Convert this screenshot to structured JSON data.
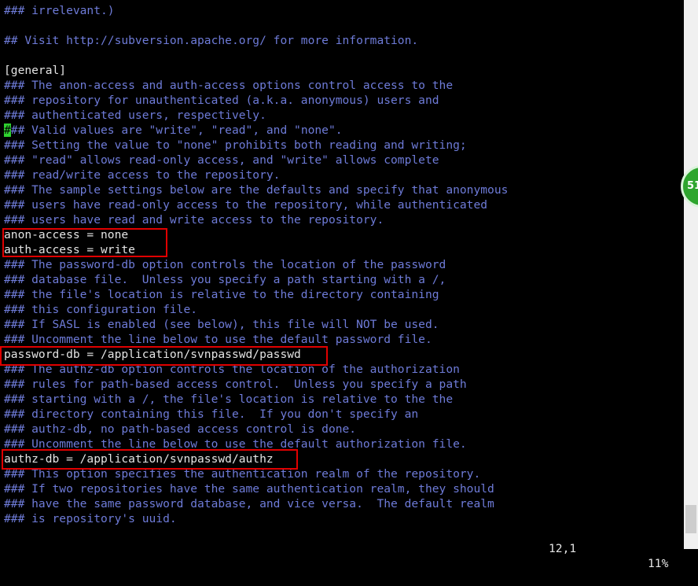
{
  "editor": {
    "lines": [
      {
        "text": "### irrelevant.)",
        "kind": "comment"
      },
      {
        "text": "",
        "kind": "blank"
      },
      {
        "text": "## Visit http://subversion.apache.org/ for more information.",
        "kind": "comment"
      },
      {
        "text": "",
        "kind": "blank"
      },
      {
        "text": "[general]",
        "kind": "text"
      },
      {
        "text": "### The anon-access and auth-access options control access to the",
        "kind": "comment"
      },
      {
        "text": "### repository for unauthenticated (a.k.a. anonymous) users and",
        "kind": "comment"
      },
      {
        "text": "### authenticated users, respectively.",
        "kind": "comment"
      },
      {
        "text": "### Valid values are \"write\", \"read\", and \"none\".",
        "kind": "comment",
        "cursor": true
      },
      {
        "text": "### Setting the value to \"none\" prohibits both reading and writing;",
        "kind": "comment"
      },
      {
        "text": "### \"read\" allows read-only access, and \"write\" allows complete",
        "kind": "comment"
      },
      {
        "text": "### read/write access to the repository.",
        "kind": "comment"
      },
      {
        "text": "### The sample settings below are the defaults and specify that anonymous",
        "kind": "comment"
      },
      {
        "text": "### users have read-only access to the repository, while authenticated",
        "kind": "comment"
      },
      {
        "text": "### users have read and write access to the repository.",
        "kind": "comment"
      },
      {
        "text": "anon-access = none",
        "kind": "text"
      },
      {
        "text": "auth-access = write",
        "kind": "text"
      },
      {
        "text": "### The password-db option controls the location of the password",
        "kind": "comment"
      },
      {
        "text": "### database file.  Unless you specify a path starting with a /,",
        "kind": "comment"
      },
      {
        "text": "### the file's location is relative to the directory containing",
        "kind": "comment"
      },
      {
        "text": "### this configuration file.",
        "kind": "comment"
      },
      {
        "text": "### If SASL is enabled (see below), this file will NOT be used.",
        "kind": "comment"
      },
      {
        "text": "### Uncomment the line below to use the default password file.",
        "kind": "comment"
      },
      {
        "text": "password-db = /application/svnpasswd/passwd",
        "kind": "text"
      },
      {
        "text": "### The authz-db option controls the location of the authorization",
        "kind": "comment"
      },
      {
        "text": "### rules for path-based access control.  Unless you specify a path",
        "kind": "comment"
      },
      {
        "text": "### starting with a /, the file's location is relative to the the",
        "kind": "comment"
      },
      {
        "text": "### directory containing this file.  If you don't specify an",
        "kind": "comment"
      },
      {
        "text": "### authz-db, no path-based access control is done.",
        "kind": "comment"
      },
      {
        "text": "### Uncomment the line below to use the default authorization file.",
        "kind": "comment"
      },
      {
        "text": "authz-db = /application/svnpasswd/authz",
        "kind": "text"
      },
      {
        "text": "### This option specifies the authentication realm of the repository.",
        "kind": "comment"
      },
      {
        "text": "### If two repositories have the same authentication realm, they should",
        "kind": "comment"
      },
      {
        "text": "### have the same password database, and vice versa.  The default realm",
        "kind": "comment"
      },
      {
        "text": "### is repository's uuid.",
        "kind": "comment"
      }
    ]
  },
  "status": {
    "position": "12,1",
    "percent": "11%"
  },
  "badge": {
    "text": "51"
  },
  "colors": {
    "background": "#000000",
    "comment": "#6e7bd8",
    "text": "#e4e4e4",
    "cursor": "#2fd12f",
    "highlight_box": "#e00000"
  }
}
